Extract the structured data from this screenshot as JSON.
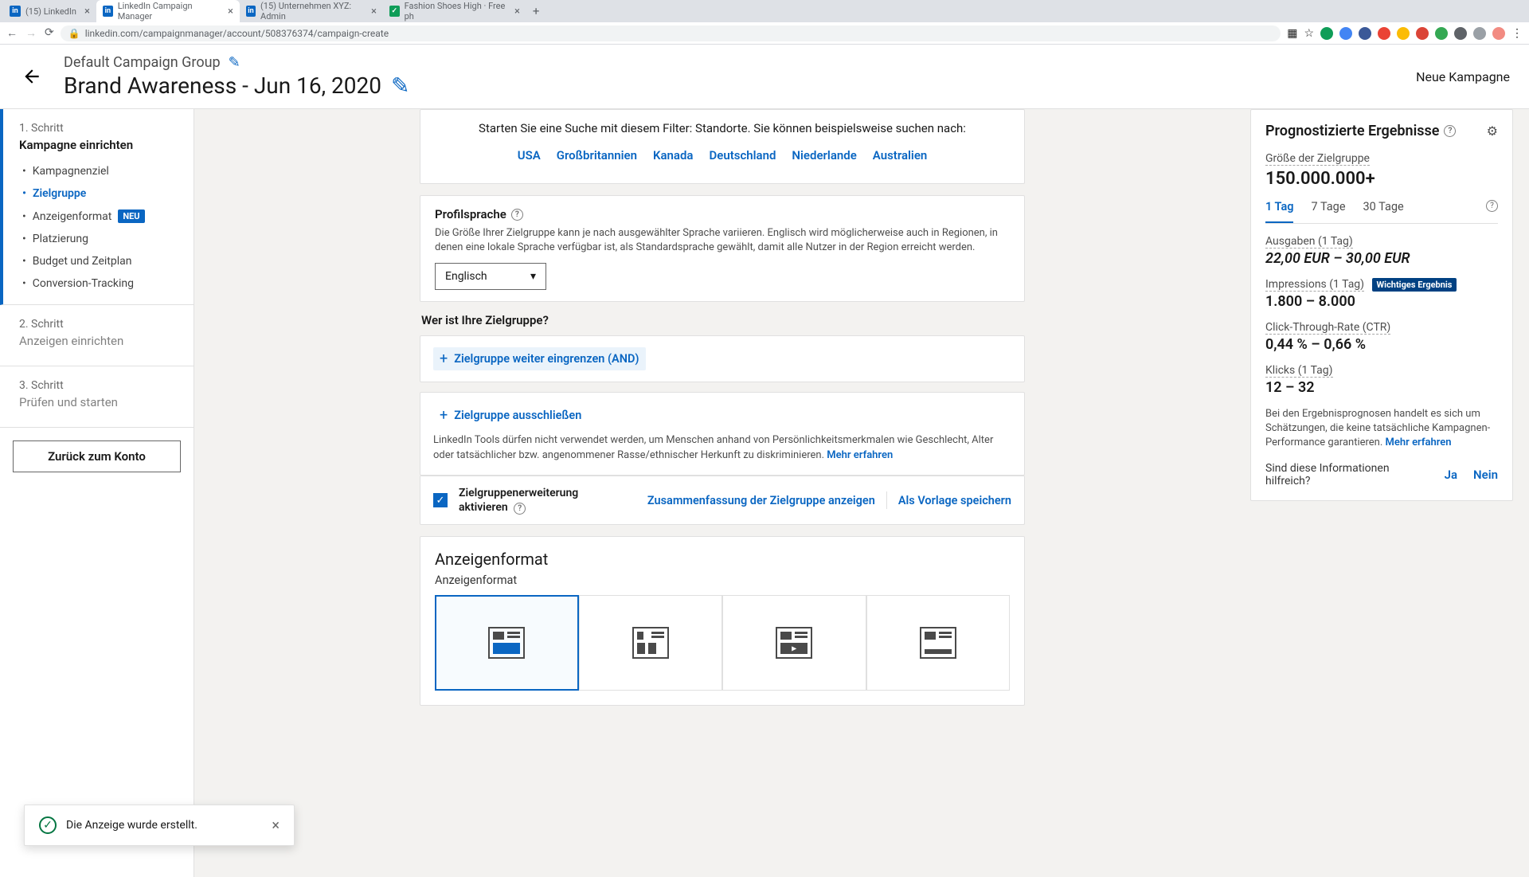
{
  "browser": {
    "tabs": [
      {
        "title": "(15) LinkedIn",
        "fav": "in"
      },
      {
        "title": "LinkedIn Campaign Manager",
        "fav": "in",
        "active": true
      },
      {
        "title": "(15) Unternehmen XYZ: Admin",
        "fav": "in"
      },
      {
        "title": "Fashion Shoes High · Free ph",
        "fav": "g"
      }
    ],
    "url": "linkedin.com/campaignmanager/account/508376374/campaign-create"
  },
  "header": {
    "group": "Default Campaign Group",
    "campaign": "Brand Awareness - Jun 16, 2020",
    "right": "Neue Kampagne"
  },
  "sidebar": {
    "step1": {
      "label": "1. Schritt",
      "title": "Kampagne einrichten"
    },
    "subs": {
      "goal": "Kampagnenziel",
      "audience": "Zielgruppe",
      "format": "Anzeigenformat",
      "format_badge": "NEU",
      "placement": "Platzierung",
      "budget": "Budget und Zeitplan",
      "tracking": "Conversion-Tracking"
    },
    "step2": {
      "label": "2. Schritt",
      "title": "Anzeigen einrichten"
    },
    "step3": {
      "label": "3. Schritt",
      "title": "Prüfen und starten"
    },
    "back": "Zurück zum Konto"
  },
  "center": {
    "filter_prompt": "Starten Sie eine Suche mit diesem Filter: Standorte. Sie können beispielsweise suchen nach:",
    "filter_links": [
      "USA",
      "Großbritannien",
      "Kanada",
      "Deutschland",
      "Niederlande",
      "Australien"
    ],
    "lang_title": "Profilsprache",
    "lang_desc": "Die Größe Ihrer Zielgruppe kann je nach ausgewählter Sprache variieren. Englisch wird möglicherweise auch in Regionen, in denen eine lokale Sprache verfügbar ist, als Standardsprache gewählt, damit alle Nutzer in der Region erreicht werden.",
    "lang_value": "Englisch",
    "who": "Wer ist Ihre Zielgruppe?",
    "narrow": "Zielgruppe weiter eingrenzen (AND)",
    "exclude": "Zielgruppe ausschließen",
    "disclaimer": "LinkedIn Tools dürfen nicht verwendet werden, um Menschen anhand von Persönlichkeitsmerkmalen wie Geschlecht, Alter oder tatsächlicher bzw. angenommener Rasse/ethnischer Herkunft zu diskriminieren.",
    "learn_more": "Mehr erfahren",
    "expansion": "Zielgruppenerweiterung aktivieren",
    "summary": "Zusammenfassung der Zielgruppe anzeigen",
    "save_template": "Als Vorlage speichern",
    "adformat_h": "Anzeigenformat",
    "adformat_sub": "Anzeigenformat"
  },
  "forecast": {
    "title": "Prognostizierte Ergebnisse",
    "size_l": "Größe der Zielgruppe",
    "size_v": "150.000.000+",
    "tabs": [
      "1 Tag",
      "7 Tage",
      "30 Tage"
    ],
    "spend_l": "Ausgaben (1 Tag)",
    "spend_v": "22,00 EUR – 30,00 EUR",
    "impr_l": "Impressions (1 Tag)",
    "impr_badge": "Wichtiges Ergebnis",
    "impr_v": "1.800 – 8.000",
    "ctr_l": "Click-Through-Rate (CTR)",
    "ctr_v": "0,44 % – 0,66 %",
    "clicks_l": "Klicks (1 Tag)",
    "clicks_v": "12 – 32",
    "note": "Bei den Ergebnisprognosen handelt es sich um Schätzungen, die keine tatsächliche Kampagnen-Performance garantieren.",
    "note_link": "Mehr erfahren",
    "helpful_q": "Sind diese Informationen hilfreich?",
    "yes": "Ja",
    "no": "Nein"
  },
  "toast": {
    "msg": "Die Anzeige wurde erstellt."
  }
}
